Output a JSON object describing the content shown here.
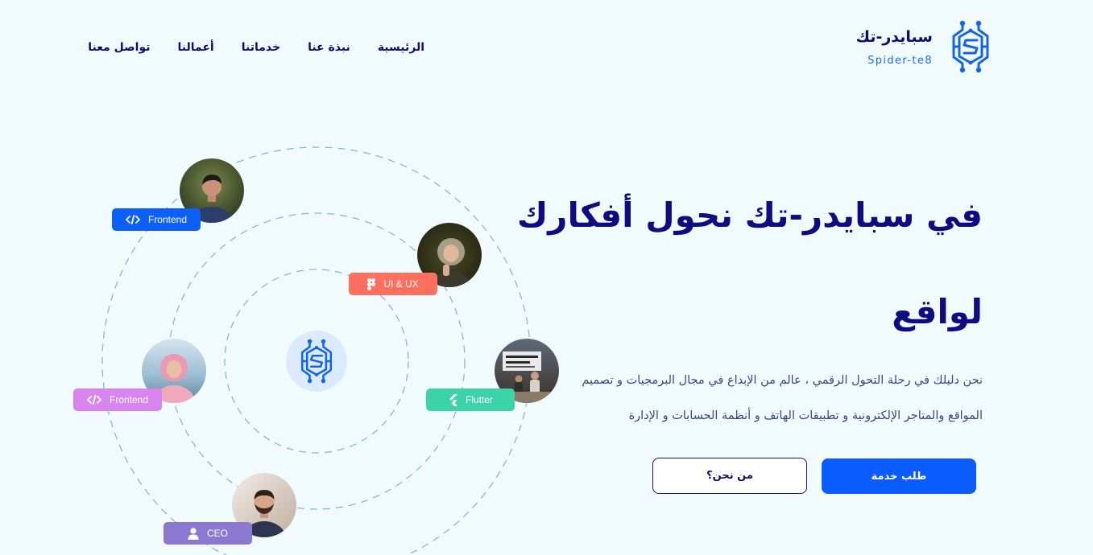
{
  "brand": {
    "name": "سبايدر-تك",
    "tagline": "Spider-te8",
    "logo_icon": "spider-circuit-logo-icon",
    "color": "#1464e6"
  },
  "nav": {
    "items": [
      {
        "label": "الرئيسية"
      },
      {
        "label": "نبذة عنا"
      },
      {
        "label": "خدماتنا"
      },
      {
        "label": "أعمالنا"
      },
      {
        "label": "تواصل معنا"
      }
    ]
  },
  "hero": {
    "title_lines": [
      "في سبايدر-تك نحول أفكارك",
      "لواقع"
    ],
    "description_lines": [
      "نحن دليلك في رحلة التحول الرقمي ، عالم من الإبداع في مجال البرمجيات و تصميم",
      "المواقع والمتاجر الإلكترونية و تطبيقات الهاتف و أنظمة الحسابات و الإدارة"
    ],
    "primary_button": "طلب خدمة",
    "secondary_button": "من نحن؟"
  },
  "team_orbit": {
    "center_icon": "spider-circuit-logo-icon",
    "members": [
      {
        "role": "Frontend",
        "icon": "code-icon",
        "color": "#0d5ffa"
      },
      {
        "role": "UI & UX",
        "icon": "figma-icon",
        "color": "#ff6f5d"
      },
      {
        "role": "Frontend",
        "icon": "code-icon",
        "color": "#d985f0"
      },
      {
        "role": "Flutter",
        "icon": "flutter-icon",
        "color": "#3bd4a7"
      },
      {
        "role": "CEO",
        "icon": "user-icon",
        "color": "#8b78d0"
      }
    ]
  },
  "colors": {
    "background": "#f1fafd",
    "primary": "#0a5cff",
    "heading": "#0f0b80",
    "nav_text": "#0e0c6e",
    "body_text": "#3a4788",
    "orbit_line": "#8fb2e4",
    "center_circle": "#dbeafc"
  }
}
